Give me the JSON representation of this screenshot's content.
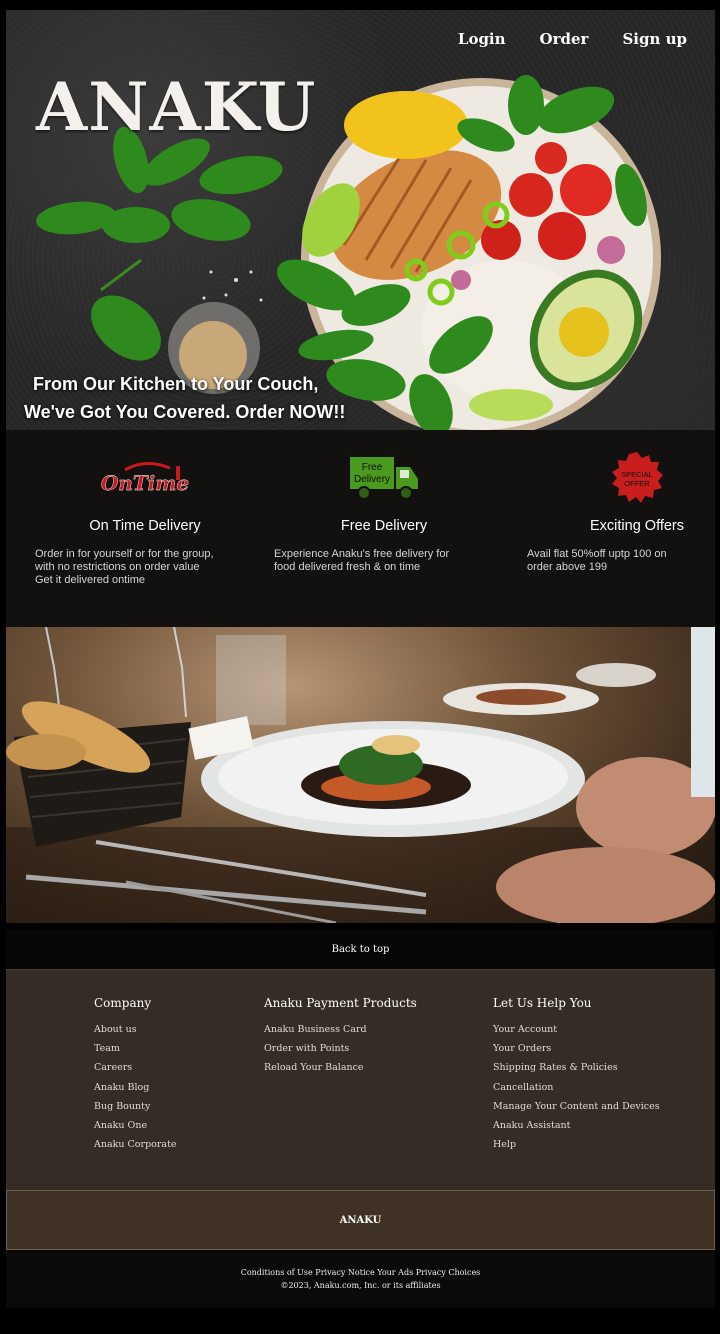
{
  "nav": {
    "login": "Login",
    "order": "Order",
    "signup": "Sign up"
  },
  "hero": {
    "logo": "ANAKU",
    "tagline_line1": "From Our Kitchen to Your Couch,",
    "tagline_line2": "We've Got You Covered. Order NOW!!"
  },
  "features": [
    {
      "icon": "ontime-icon",
      "icon_text": "OnTime",
      "title": "On Time Delivery",
      "text": "Order in for yourself or for the group,\nwith no restrictions on order value\nGet it delivered ontime"
    },
    {
      "icon": "truck-icon",
      "icon_text_1": "Free",
      "icon_text_2": "Delivery",
      "title": "Free Delivery",
      "text": "Experience Anaku's free delivery for\nfood delivered fresh & on time"
    },
    {
      "icon": "special-offer-badge-icon",
      "icon_text_1": "SPECIAL",
      "icon_text_2": "OFFER",
      "title": "Exciting Offers",
      "text": "Avail flat 50%off uptp 100 on\norder above 199"
    }
  ],
  "back_to_top": "Back to top",
  "footer": {
    "columns": [
      {
        "heading": "Company",
        "links": [
          "About us",
          "Team",
          "Careers",
          "Anaku Blog",
          "Bug Bounty",
          "Anaku One",
          "Anaku Corporate"
        ]
      },
      {
        "heading": "Anaku Payment Products",
        "links": [
          "Anaku Business Card",
          "Order with Points",
          "Reload Your Balance"
        ]
      },
      {
        "heading": "Let Us Help You",
        "links": [
          "Your Account",
          "Your Orders",
          "Shipping Rates & Policies",
          "Cancellation",
          "Manage Your Content and Devices",
          "Anaku Assistant",
          "Help"
        ]
      }
    ],
    "brand": "ANAKU",
    "legal_links": "Conditions of Use Privacy Notice Your Ads Privacy Choices",
    "copyright": "©2023, Anaku.com, Inc. or its affiliates"
  },
  "colors": {
    "ontime_red": "#c8191e",
    "truck_green": "#4a9a1e",
    "badge_red": "#c81e1e",
    "footer_brown": "#352d25"
  }
}
